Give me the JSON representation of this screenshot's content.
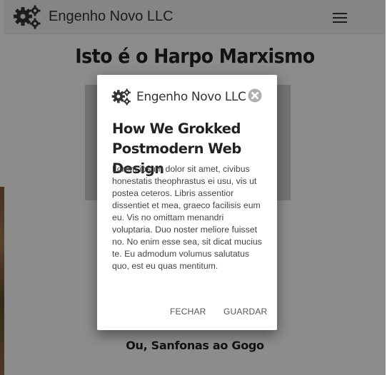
{
  "navbar": {
    "brand": "Engenho Novo LLC",
    "logo_icon": "gears-icon",
    "menu_icon": "hamburger-menu-icon"
  },
  "page": {
    "hero_title": "Isto é o Harpo Marxismo",
    "subtitle": "Ou, Sanfonas ao Gogo"
  },
  "modal": {
    "logo_icon": "gears-icon",
    "brand": "Engenho Novo LLC",
    "close_icon": "close-circle-icon",
    "heading": "How We Grokked Postmodern Web Design",
    "body": "Lorem ipsum dolor sit amet, civibus honestatis theophrastus ei usu, vis ut postea ceteros. Libris assentior dissentiet et mea, graeco facilisis eum eu. Vis no omittam menandri voluptaria. Duo noster meliore fuisset no. No enim esse sea, sit dicat mucius te. Eu admodum volumus salutatus quo, est eu quas mentitum.",
    "cancel_label": "FECHAR",
    "save_label": "GUARDAR"
  },
  "colors": {
    "overlay": "#8a8a8a",
    "modal_bg": "#ffffff",
    "text_dark": "#222222",
    "close_icon": "#b0b0b0"
  }
}
